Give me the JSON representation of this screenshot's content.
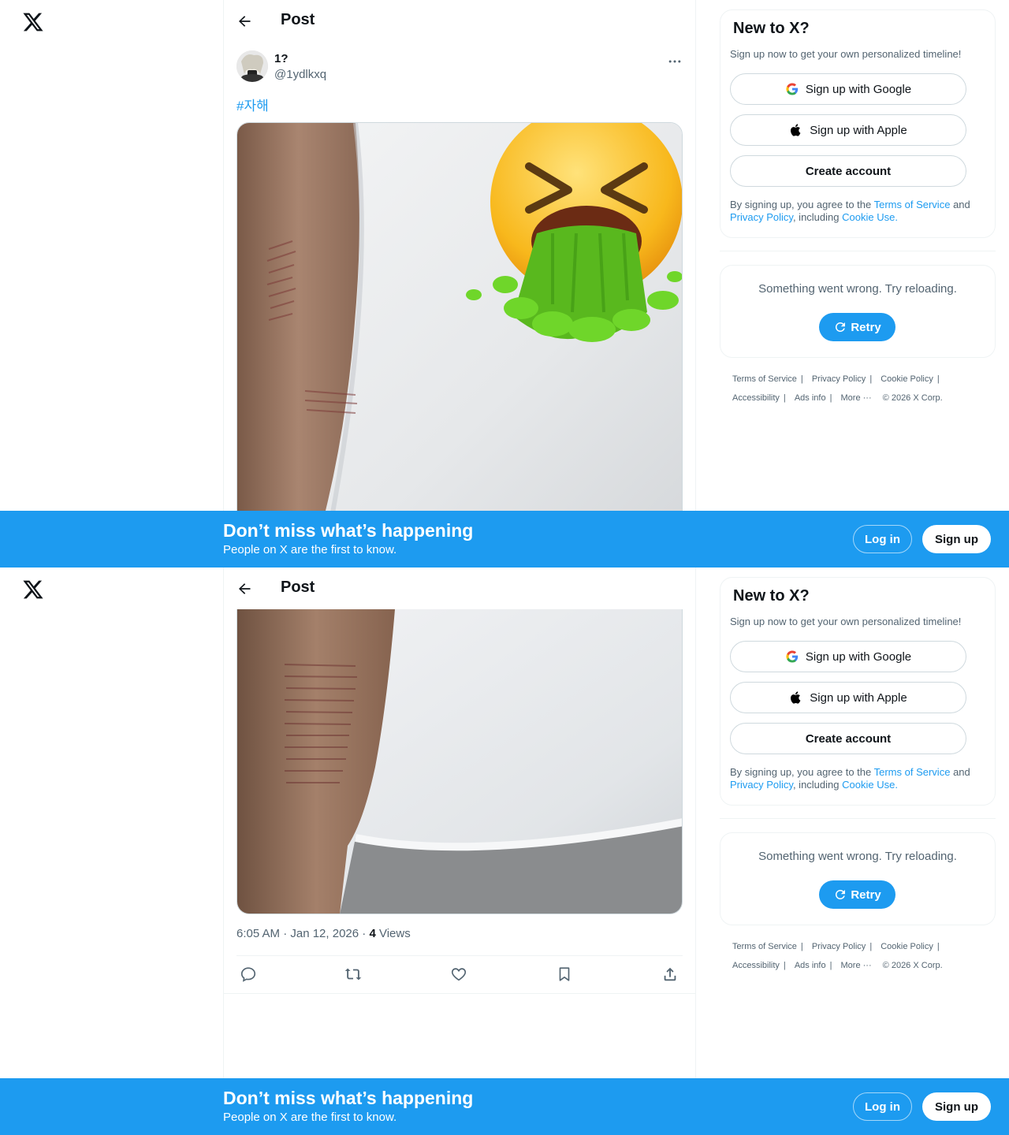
{
  "header": {
    "title": "Post",
    "back_label": "Back"
  },
  "post": {
    "author_name": "1?",
    "author_handle": "@1ydlkxq",
    "hashtag": "#자해",
    "time": "6:05 AM · Jan 12, 2026",
    "views_count": "4",
    "views_label": "Views",
    "media_emoji": "face-vomiting-emoji"
  },
  "actions": [
    "reply-icon",
    "repost-icon",
    "like-icon",
    "bookmark-icon",
    "share-icon"
  ],
  "signup_card": {
    "title": "New to X?",
    "subtitle": "Sign up now to get your own personalized timeline!",
    "google_label": "Sign up with Google",
    "apple_label": "Sign up with Apple",
    "create_label": "Create account",
    "terms_prefix": "By signing up, you agree to the",
    "terms_link": "Terms of Service",
    "terms_and": "and",
    "privacy_link": "Privacy Policy",
    "including": ", including",
    "cookie_link": "Cookie Use."
  },
  "error_card": {
    "message": "Something went wrong. Try reloading.",
    "retry_label": "Retry"
  },
  "footer": {
    "terms": "Terms of Service",
    "privacy": "Privacy Policy",
    "cookie": "Cookie Policy",
    "accessibility": "Accessibility",
    "ads": "Ads info",
    "more": "More ···",
    "copyright": "© 2026 X Corp."
  },
  "banner": {
    "title": "Don’t miss what’s happening",
    "subtitle": "People on X are the first to know.",
    "login_label": "Log in",
    "signup_label": "Sign up"
  },
  "colors": {
    "accent": "#1d9bf0",
    "text": "#0f1419",
    "muted": "#536471"
  }
}
